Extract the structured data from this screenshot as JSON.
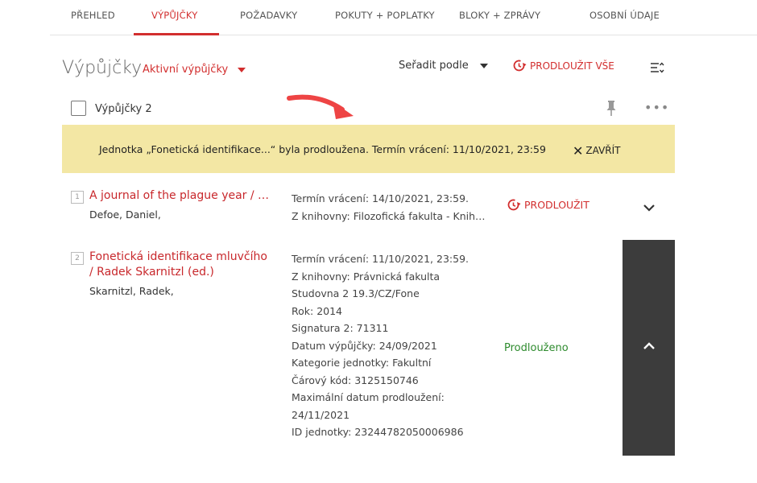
{
  "tabs": [
    {
      "label": "PŘEHLED"
    },
    {
      "label": "VÝPŮJČKY"
    },
    {
      "label": "POŽADAVKY"
    },
    {
      "label": "POKUTY + POPLATKY"
    },
    {
      "label": "BLOKY + ZPRÁVY"
    },
    {
      "label": "OSOBNÍ ÚDAJE"
    }
  ],
  "header": {
    "title": "Výpůjčky",
    "filter": "Aktivní výpůjčky",
    "sort": "Seřadit podle",
    "renew_all": "PRODLOUŽIT VŠE"
  },
  "selection": {
    "label": "Výpůjčky 2"
  },
  "notice": {
    "text": "Jednotka „Fonetická identifikace...“ byla prodloužena. Termín vrácení: 11/10/2021, 23:59",
    "close": "ZAVŘÍT"
  },
  "loans": [
    {
      "number": "1",
      "title": "A journal of the plague year / …",
      "author": "Defoe, Daniel,",
      "details": [
        "Termín vrácení: 14/10/2021, 23:59.",
        "Z knihovny: Filozofická fakulta - Knih…"
      ],
      "action": "PRODLOUŽIT"
    },
    {
      "number": "2",
      "title_lines": [
        "Fonetická identifikace mluvčího",
        "/ Radek Skarnitzl (ed.)"
      ],
      "author": "Skarnitzl, Radek,",
      "details": [
        "Termín vrácení: 11/10/2021, 23:59.",
        "Z knihovny: Právnická fakulta",
        "Studovna 2 19.3/CZ/Fone",
        "Rok: 2014",
        "Signatura 2: 71311",
        "Datum výpůjčky: 24/09/2021",
        "Kategorie jednotky: Fakultní",
        "Čárový kód: 3125150746",
        "Maximální datum prodloužení:",
        "24/11/2021",
        "ID jednotky: 23244782050006986"
      ],
      "status": "Prodlouženo"
    }
  ],
  "colors": {
    "accent": "#d22e2e",
    "notice_bg": "#f3e7a4",
    "success": "#2e8b2e",
    "panel": "#3c3c3c"
  }
}
